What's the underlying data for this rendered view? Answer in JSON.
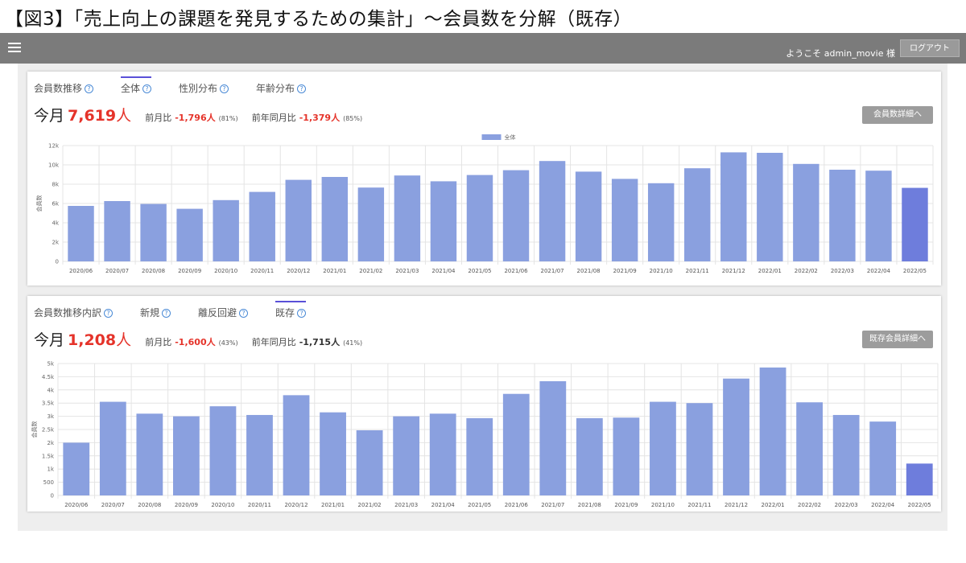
{
  "figure_title": "【図3】「売上向上の課題を発見するための集計」〜会員数を分解（既存）",
  "header": {
    "welcome": "ようこそ admin_movie 様",
    "logout_label": "ログアウト"
  },
  "panel1": {
    "tabs": [
      {
        "label": "会員数推移",
        "active": false,
        "help": "?"
      },
      {
        "label": "全体",
        "active": true,
        "help": "?"
      },
      {
        "label": "性別分布",
        "active": false,
        "help": "?"
      },
      {
        "label": "年齢分布",
        "active": false,
        "help": "?"
      }
    ],
    "summary": {
      "label": "今月",
      "value": "7,619",
      "unit": "人",
      "mom_label": "前月比",
      "mom_value": "-1,796人",
      "mom_pct": "(81%)",
      "yoy_label": "前年同月比",
      "yoy_value": "-1,379人",
      "yoy_pct": "(85%)"
    },
    "detail_button": "会員数詳細へ"
  },
  "panel2": {
    "tabs": [
      {
        "label": "会員数推移内訳",
        "active": false,
        "help": "?"
      },
      {
        "label": "新規",
        "active": false,
        "help": "?"
      },
      {
        "label": "離反回避",
        "active": false,
        "help": "?"
      },
      {
        "label": "既存",
        "active": true,
        "help": "?"
      }
    ],
    "summary": {
      "label": "今月",
      "value": "1,208",
      "unit": "人",
      "mom_label": "前月比",
      "mom_value": "-1,600人",
      "mom_pct": "(43%)",
      "yoy_label": "前年同月比",
      "yoy_value": "-1,715人",
      "yoy_pct": "(41%)"
    },
    "detail_button": "既存会員詳細へ"
  },
  "colors": {
    "bar": "#8aa0df",
    "bar_last": "#6e7ddc",
    "grid": "#e4e4e4",
    "accent": "#e5332a"
  },
  "chart_data": [
    {
      "type": "bar",
      "categories": [
        "2020/06",
        "2020/07",
        "2020/08",
        "2020/09",
        "2020/10",
        "2020/11",
        "2020/12",
        "2021/01",
        "2021/02",
        "2021/03",
        "2021/04",
        "2021/05",
        "2021/06",
        "2021/07",
        "2021/08",
        "2021/09",
        "2021/10",
        "2021/11",
        "2021/12",
        "2022/01",
        "2022/02",
        "2022/03",
        "2022/04",
        "2022/05"
      ],
      "series": [
        {
          "name": "全体",
          "values": [
            5750,
            6250,
            5950,
            5450,
            6350,
            7200,
            8450,
            8750,
            7650,
            8900,
            8300,
            8950,
            9450,
            10400,
            9300,
            8550,
            8100,
            9650,
            11300,
            11250,
            10100,
            9500,
            9400,
            7619
          ]
        }
      ],
      "ylabel": "会員数",
      "ylim": [
        0,
        12000
      ],
      "yticks": [
        0,
        2000,
        4000,
        6000,
        8000,
        10000,
        12000
      ],
      "ytick_labels": [
        "0",
        "2k",
        "4k",
        "6k",
        "8k",
        "10k",
        "12k"
      ],
      "legend": "top-center",
      "grid": true
    },
    {
      "type": "bar",
      "categories": [
        "2020/06",
        "2020/07",
        "2020/08",
        "2020/09",
        "2020/10",
        "2020/11",
        "2020/12",
        "2021/01",
        "2021/02",
        "2021/03",
        "2021/04",
        "2021/05",
        "2021/06",
        "2021/07",
        "2021/08",
        "2021/09",
        "2021/10",
        "2021/11",
        "2021/12",
        "2022/01",
        "2022/02",
        "2022/03",
        "2022/04",
        "2022/05"
      ],
      "series": [
        {
          "values": [
            2000,
            3550,
            3100,
            3000,
            3380,
            3050,
            3800,
            3150,
            2470,
            3000,
            3100,
            2930,
            3850,
            4330,
            2930,
            2950,
            3550,
            3500,
            4430,
            4850,
            3530,
            3050,
            2800,
            1208
          ]
        }
      ],
      "ylabel": "会員数",
      "ylim": [
        0,
        5000
      ],
      "yticks": [
        0,
        500,
        1000,
        1500,
        2000,
        2500,
        3000,
        3500,
        4000,
        4500,
        5000
      ],
      "ytick_labels": [
        "0",
        "500",
        "1k",
        "1.5k",
        "2k",
        "2.5k",
        "3k",
        "3.5k",
        "4k",
        "4.5k",
        "5k"
      ],
      "grid": true
    }
  ]
}
